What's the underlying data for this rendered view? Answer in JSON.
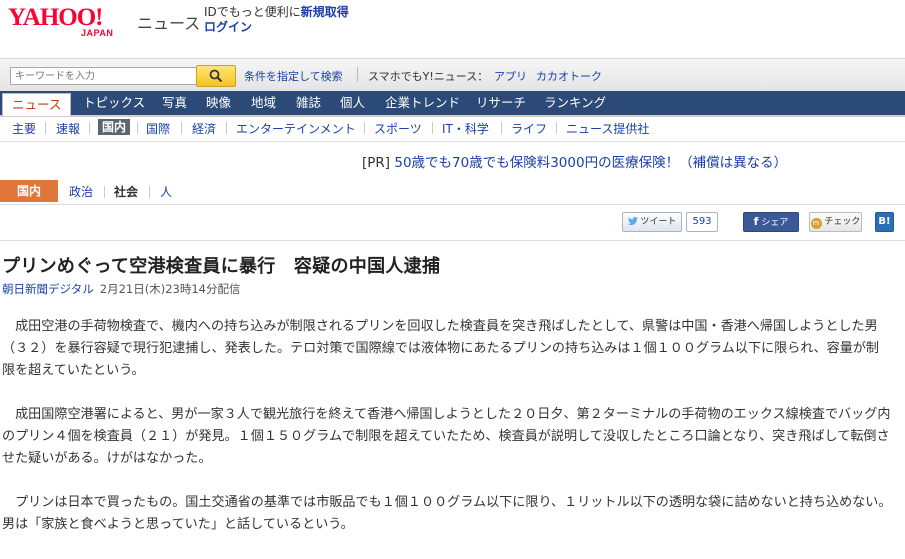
{
  "header": {
    "logo_text": "YAHOO!",
    "logo_sub": "JAPAN",
    "service_name": "ニュース",
    "promo_text": "IDでもっと便利に",
    "promo_link": "新規取得",
    "login_link": "ログイン"
  },
  "search": {
    "placeholder": "キーワードを入力",
    "advanced_link": "条件を指定して検索",
    "smartphone_label": "スマホでもY!ニュース：",
    "app_link": "アプリ",
    "kakao_link": "カカオトーク"
  },
  "global_nav": [
    {
      "label": "ニュース"
    },
    {
      "label": "トピックス"
    },
    {
      "label": "写真"
    },
    {
      "label": "映像"
    },
    {
      "label": "地域"
    },
    {
      "label": "雑誌"
    },
    {
      "label": "個人"
    },
    {
      "label": "企業トレンド"
    },
    {
      "label": "リサーチ"
    },
    {
      "label": "ランキング"
    }
  ],
  "sub_nav": [
    {
      "label": "主要"
    },
    {
      "label": "速報"
    },
    {
      "label": "国内"
    },
    {
      "label": "国際"
    },
    {
      "label": "経済"
    },
    {
      "label": "エンターテインメント"
    },
    {
      "label": "スポーツ"
    },
    {
      "label": "IT・科学"
    },
    {
      "label": "ライフ"
    },
    {
      "label": "ニュース提供社"
    }
  ],
  "ad": {
    "tag": "[PR]",
    "text": "50歳でも70歳でも保険料3000円の医療保険！（補償は異なる）"
  },
  "category_tabs": {
    "active": "国内",
    "items": [
      {
        "label": "政治"
      },
      {
        "label": "社会"
      },
      {
        "label": "人"
      }
    ]
  },
  "social": {
    "tweet_label": "ツイート",
    "tweet_count": "593",
    "facebook_label": "シェア",
    "mixi_label": "チェック",
    "hatena_label": "B!"
  },
  "article": {
    "headline": "プリンめぐって空港検査員に暴行　容疑の中国人逮捕",
    "source": "朝日新聞デジタル",
    "date": "2月21日(木)23時14分配信",
    "paragraphs": [
      "成田空港の手荷物検査で、機内への持ち込みが制限されるプリンを回収した検査員を突き飛ばしたとして、県警は中国・香港へ帰国しようとした男（３２）を暴行容疑で現行犯逮捕し、発表した。テロ対策で国際線では液体物にあたるプリンの持ち込みは１個１００グラム以下に限られ、容量が制限を超えていたという。",
      "成田国際空港署によると、男が一家３人で観光旅行を終えて香港へ帰国しようとした２０日夕、第２ターミナルの手荷物のエックス線検査でバッグ内のプリン４個を検査員（２１）が発見。１個１５０グラムで制限を超えていたため、検査員が説明して没収したところ口論となり、突き飛ばして転倒させた疑いがある。けがはなかった。",
      "プリンは日本で買ったもの。国土交通省の基準では市販品でも１個１００グラム以下に限り、１リットル以下の透明な袋に詰めないと持ち込めない。男は「家族と食べようと思っていた」と話しているという。"
    ]
  },
  "colors": {
    "brand_red": "#ff0033",
    "nav_bg": "#2b4a77",
    "link": "#1a3fa8",
    "category_active": "#e0763a"
  }
}
